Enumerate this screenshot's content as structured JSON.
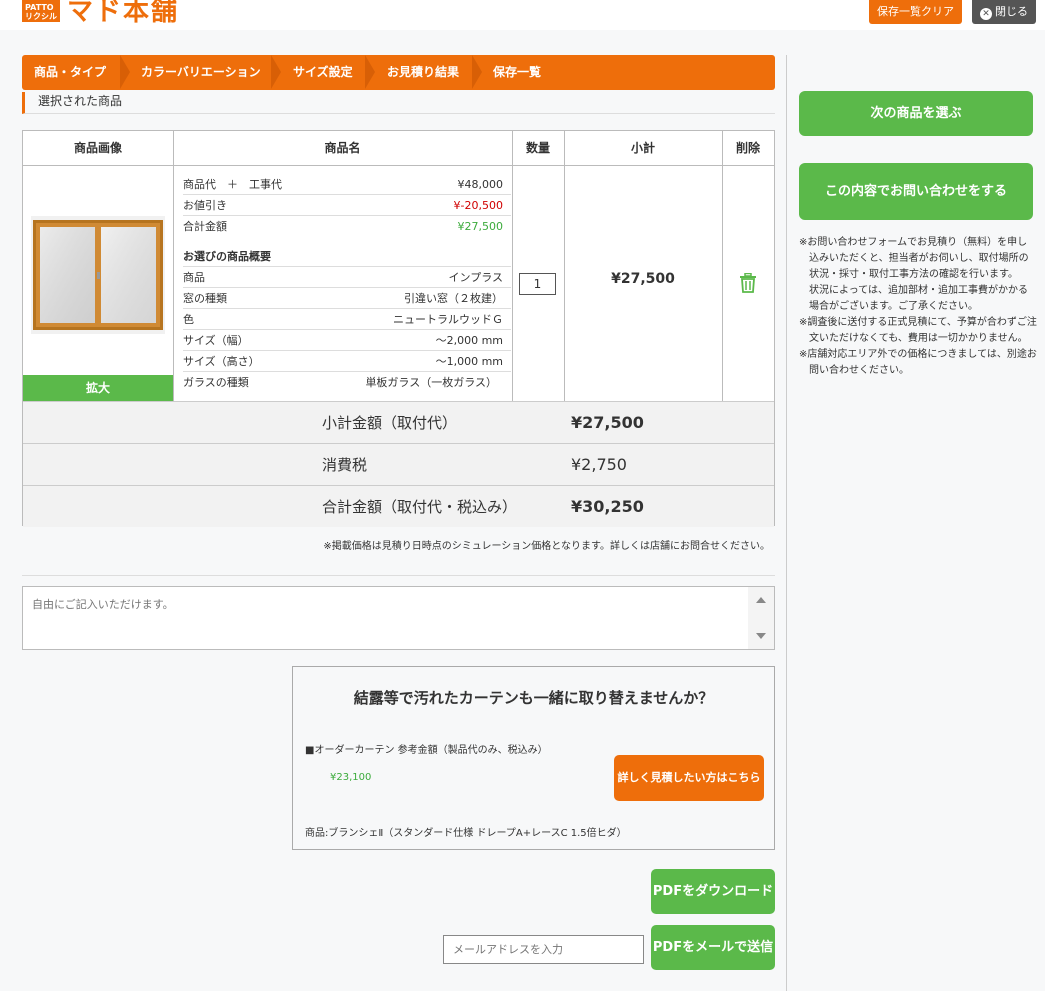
{
  "header": {
    "logo_badge": "PATTO リクシル",
    "logo_text": "マド本舗",
    "clear_label": "保存一覧クリア",
    "close_label": "閉じる"
  },
  "steps": [
    "商品・タイプ",
    "カラーバリエーション",
    "サイズ設定",
    "お見積り結果",
    "保存一覧"
  ],
  "section_title": "選択された商品",
  "table": {
    "headers": [
      "商品画像",
      "商品名",
      "数量",
      "小計",
      "削除"
    ],
    "zoom_label": "拡大",
    "price_rows": [
      {
        "label": "商品代　＋　工事代",
        "value": "¥48,000"
      },
      {
        "label": "お値引き",
        "value": "¥-20,500"
      },
      {
        "label": "合計金額",
        "value": "¥27,500"
      }
    ],
    "summary_heading": "お選びの商品概要",
    "spec_rows": [
      {
        "label": "商品",
        "value": "インプラス"
      },
      {
        "label": "窓の種類",
        "value": "引違い窓（２枚建）"
      },
      {
        "label": "色",
        "value": "ニュートラルウッドＧ"
      },
      {
        "label": "サイズ（幅）",
        "value": "〜2,000 mm"
      },
      {
        "label": "サイズ（高さ）",
        "value": "〜1,000 mm"
      },
      {
        "label": "ガラスの種類",
        "value": "単板ガラス（一枚ガラス）"
      }
    ],
    "quantity": "1",
    "subtotal": "¥27,500"
  },
  "totals": [
    {
      "label": "小計金額（取付代）",
      "value": "¥27,500"
    },
    {
      "label": "消費税",
      "value": "¥2,750"
    },
    {
      "label": "合計金額（取付代・税込み）",
      "value": "¥30,250"
    }
  ],
  "price_note": "※掲載価格は見積り日時点のシミュレーション価格となります。詳しくは店舗にお問合せください。",
  "memo_placeholder": "自由にご記入いただけます。",
  "curtain": {
    "title": "結露等で汚れたカーテンも一緒に取り替えませんか？",
    "label": "■オーダーカーテン 参考金額（製品代のみ、税込み）",
    "price": "¥23,100",
    "detail_button": "詳しく見積したい方はこちら",
    "product": "商品:ブランシェⅡ（スタンダード仕様 ドレープA+レースC 1.5倍ヒダ）"
  },
  "pdf_download_label": "PDFをダウンロード",
  "email_placeholder": "メールアドレスを入力",
  "pdf_mail_label": "PDFをメールで送信",
  "sidebar": {
    "next_label": "次の商品を選ぶ",
    "inquiry_label": "この内容でお問い合わせをする",
    "notes": [
      "※お問い合わせフォームでお見積り（無料）を申し込みいただくと、担当者がお伺いし、取付場所の状況・採寸・取付工事方法の確認を行います。",
      "　状況によっては、追加部材・追加工事費がかかる場合がございます。ご了承ください。",
      "※調査後に送付する正式見積にて、予算が合わずご注文いただけなくても、費用は一切かかりません。",
      "※店舗対応エリア外での価格につきましては、別途お問い合わせください。"
    ]
  },
  "colors": {
    "orange": "#ee6e0b",
    "green": "#5bb94a",
    "discount_red": "#d00000",
    "total_green": "#3cab3c"
  }
}
